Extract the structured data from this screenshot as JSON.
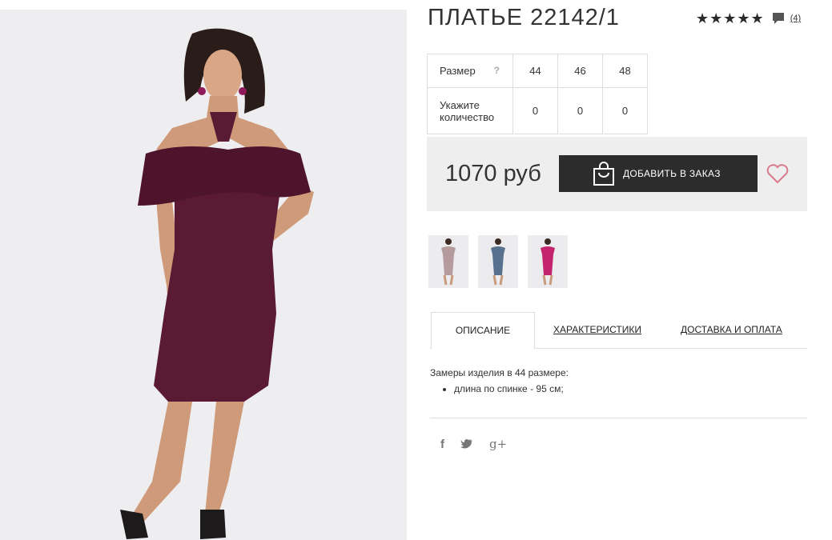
{
  "product": {
    "title": "ПЛАТЬЕ 22142/1",
    "rating_stars": "★★★★★",
    "review_count": "(4)"
  },
  "sizes": {
    "size_label": "Размер",
    "help_icon": "?",
    "sizes": [
      "44",
      "46",
      "48"
    ],
    "quantity_label_line1": "Укажите",
    "quantity_label_line2": "количество",
    "quantities": [
      "0",
      "0",
      "0"
    ]
  },
  "purchase": {
    "price": "1070 руб",
    "add_to_cart_label": "ДОБАВИТЬ В ЗАКАЗ"
  },
  "thumbnails": [
    {
      "color": "#b59a9e",
      "alt": "mauve"
    },
    {
      "color": "#56708e",
      "alt": "blue"
    },
    {
      "color": "#c3246d",
      "alt": "magenta"
    }
  ],
  "tabs": {
    "description": "ОПИСАНИЕ",
    "characteristics": "ХАРАКТЕРИСТИКИ",
    "delivery": "ДОСТАВКА И ОПЛАТА"
  },
  "description": {
    "intro": "Замеры изделия в 44 размере:",
    "items": [
      "длина по спинке - 95 см;"
    ]
  },
  "social": {
    "facebook": "f",
    "twitter": "t",
    "googleplus": "g+"
  },
  "colors": {
    "dress": "#5a1a33",
    "button": "#2c2c2c",
    "heart": "#d97a8a",
    "panel": "#eeeeee"
  }
}
